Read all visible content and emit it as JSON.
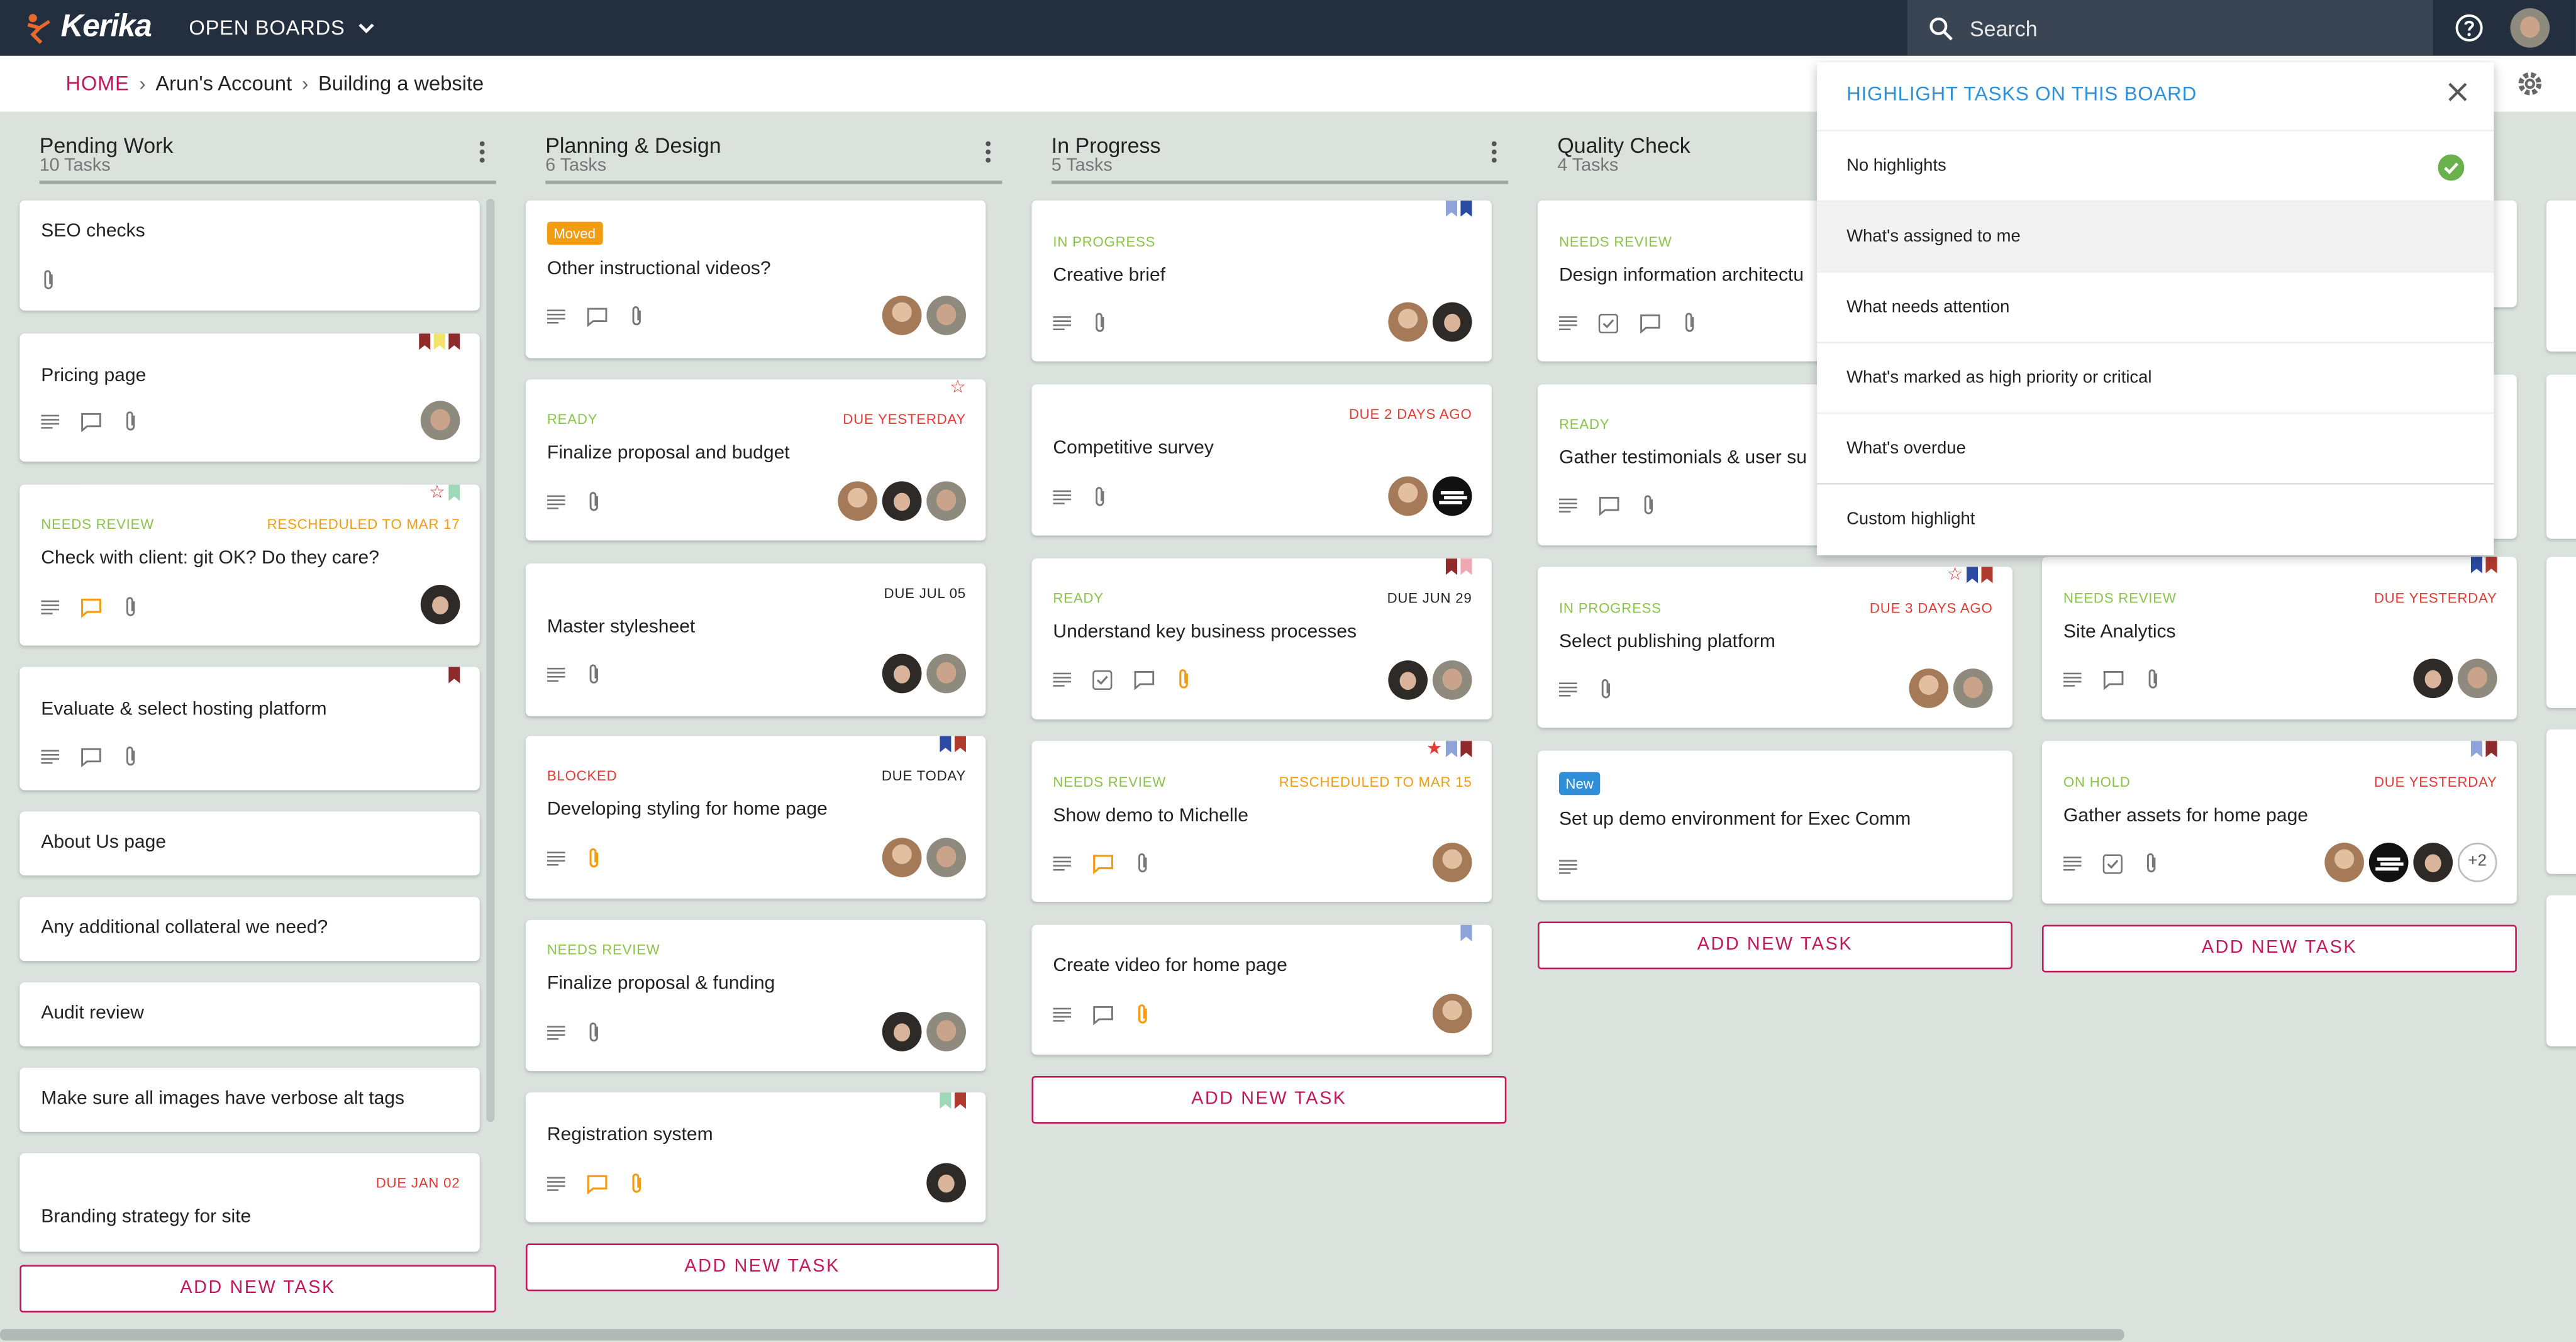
{
  "app": {
    "logo": "Kerika",
    "open_boards": "OPEN BOARDS"
  },
  "search": {
    "placeholder": "Search"
  },
  "breadcrumb": {
    "home": "HOME",
    "account": "Arun's Account",
    "board": "Building a website"
  },
  "columns": [
    {
      "title": "Pending Work",
      "count": "10 Tasks",
      "cards": [
        {
          "title": "SEO checks"
        },
        {
          "title": "Pricing page"
        },
        {
          "status": "NEEDS REVIEW",
          "due": "RESCHEDULED TO MAR 17",
          "title": "Check with client: git OK? Do they care?"
        },
        {
          "title": "Evaluate & select hosting platform"
        },
        {
          "title": "About Us page"
        },
        {
          "title": "Any additional collateral we need?"
        },
        {
          "title": "Audit review"
        },
        {
          "title": "Make sure all images have verbose alt tags"
        },
        {
          "due": "DUE JAN 02",
          "title": "Branding strategy for site"
        }
      ]
    },
    {
      "title": "Planning & Design",
      "count": "6 Tasks",
      "cards": [
        {
          "badge": "Moved",
          "title": "Other instructional videos?"
        },
        {
          "status": "READY",
          "due": "DUE YESTERDAY",
          "title": "Finalize proposal and budget"
        },
        {
          "due": "DUE JUL 05",
          "title": "Master stylesheet"
        },
        {
          "status": "BLOCKED",
          "due": "DUE TODAY",
          "title": "Developing styling for home page"
        },
        {
          "status": "NEEDS REVIEW",
          "title": "Finalize proposal & funding"
        },
        {
          "title": "Registration system"
        }
      ]
    },
    {
      "title": "In Progress",
      "count": "5 Tasks",
      "cards": [
        {
          "status": "IN PROGRESS",
          "title": "Creative brief"
        },
        {
          "due": "DUE 2 DAYS AGO",
          "title": "Competitive survey"
        },
        {
          "status": "READY",
          "due": "DUE JUN 29",
          "title": "Understand key business processes"
        },
        {
          "status": "NEEDS REVIEW",
          "due": "RESCHEDULED TO MAR 15",
          "title": "Show demo to Michelle"
        },
        {
          "title": "Create video for home page"
        }
      ]
    },
    {
      "title": "Quality Check",
      "count": "4 Tasks",
      "cards": [
        {
          "status": "NEEDS REVIEW",
          "title": "Design information architectu"
        },
        {
          "status": "READY",
          "title": "Gather testimonials & user su"
        },
        {
          "status": "IN PROGRESS",
          "due": "DUE 3 DAYS AGO",
          "title": "Select publishing platform"
        },
        {
          "badge": "New",
          "title": "Set up demo environment for Exec Comm"
        }
      ]
    },
    {
      "cards": [
        {
          "status": "NEEDS REVIEW",
          "due": "DUE YESTERDAY",
          "title": "Site Analytics"
        },
        {
          "status": "ON HOLD",
          "due": "DUE YESTERDAY",
          "title": "Gather assets for home page",
          "extra": "+2"
        }
      ]
    }
  ],
  "add_task_label": "ADD NEW TASK",
  "highlight_menu": {
    "title": "HIGHLIGHT TASKS ON THIS BOARD",
    "options": [
      "No highlights",
      "What's assigned to me",
      "What needs attention",
      "What's marked as high priority or critical",
      "What's overdue",
      "Custom highlight"
    ],
    "selected": "No highlights"
  },
  "colors": {
    "brand": "#c2185b",
    "topbar": "#232f3e",
    "status_green": "#8bc34a",
    "status_red": "#e53935",
    "status_orange": "#f39c12",
    "menu_title": "#2f8fd8"
  }
}
